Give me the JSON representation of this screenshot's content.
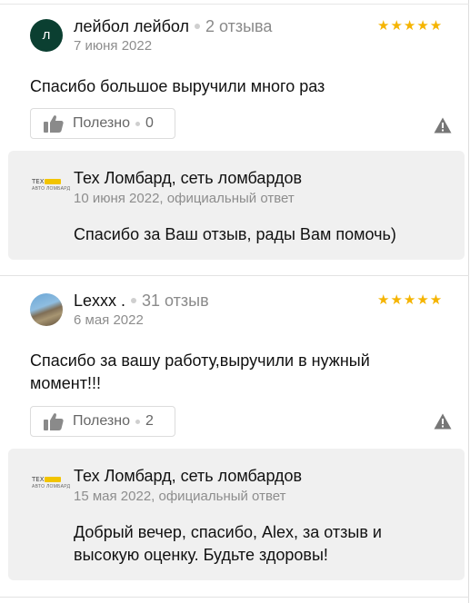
{
  "reviews": [
    {
      "avatar_letter": "л",
      "name": "лейбол лейбол",
      "count": "2 отзыва",
      "date": "7 июня 2022",
      "rating": 5,
      "stars": "★★★★★",
      "text": "Спасибо большое выручили много раз",
      "useful_label": "Полезно",
      "useful_count": "0",
      "reply": {
        "logo_top": "ТЕХ",
        "logo_bottom": "АВТО ЛОМБАРД",
        "name": "Тех Ломбард, сеть ломбардов",
        "meta": "10 июня 2022, официальный ответ",
        "text": "Спасибо за Ваш отзыв, рады Вам помочь)"
      }
    },
    {
      "name": "Lexxx .",
      "count": "31 отзыв",
      "date": "6 мая 2022",
      "rating": 5,
      "stars": "★★★★★",
      "text": "Спасибо за вашу работу,выручили в нужный момент!!!",
      "useful_label": "Полезно",
      "useful_count": "2",
      "reply": {
        "logo_top": "ТЕХ",
        "logo_bottom": "АВТО ЛОМБАРД",
        "name": "Тех Ломбард, сеть ломбардов",
        "meta": "15 мая 2022, официальный ответ",
        "text": "Добрый вечер, спасибо, Alex, за отзыв и высокую оценку. Будьте здоровы!"
      }
    }
  ],
  "colors": {
    "star": "#f5b400",
    "avatar_green": "#0b3f31",
    "reply_bg": "#f0f0f0"
  }
}
